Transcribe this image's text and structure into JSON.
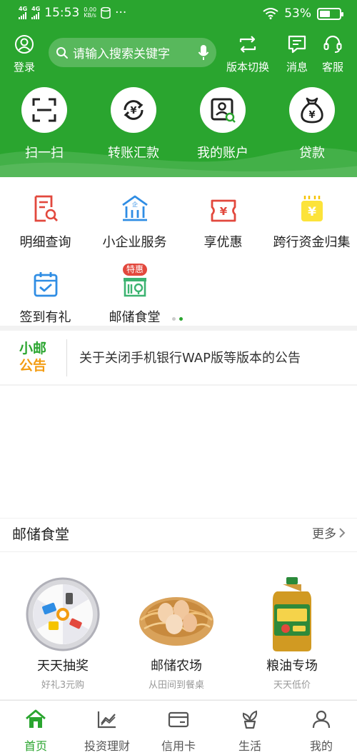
{
  "status_bar": {
    "net1": "4G",
    "net2": "4G",
    "time": "15:53",
    "speed_value": "0.00",
    "speed_unit": "KB/s",
    "more": "···",
    "battery": "53%"
  },
  "topbar": {
    "login": "登录",
    "search_placeholder": "请输入搜索关键字",
    "version_switch": "版本切换",
    "messages": "消息",
    "service": "客服"
  },
  "quick_actions": [
    {
      "label": "扫一扫",
      "icon": "scan-icon"
    },
    {
      "label": "转账汇款",
      "icon": "transfer-icon"
    },
    {
      "label": "我的账户",
      "icon": "account-icon"
    },
    {
      "label": "贷款",
      "icon": "loan-bag-icon"
    }
  ],
  "services": [
    {
      "label": "明细查询",
      "icon": "detail-query-icon"
    },
    {
      "label": "小企业服务",
      "icon": "enterprise-icon"
    },
    {
      "label": "享优惠",
      "icon": "coupon-icon"
    },
    {
      "label": "跨行资金归集",
      "icon": "fund-collection-icon"
    },
    {
      "label": "签到有礼",
      "icon": "checkin-icon"
    },
    {
      "label": "邮储食堂",
      "icon": "canteen-icon",
      "badge": "特惠"
    }
  ],
  "pager": {
    "count": 2,
    "active": 1
  },
  "notice": {
    "badge_line1": "小邮",
    "badge_line2": "公告",
    "text": "关于关闭手机银行WAP版等版本的公告"
  },
  "canteen": {
    "title": "邮储食堂",
    "more": "更多",
    "items": [
      {
        "name": "天天抽奖",
        "sub": "好礼3元购"
      },
      {
        "name": "邮储农场",
        "sub": "从田间到餐桌"
      },
      {
        "name": "粮油专场",
        "sub": "天天低价"
      }
    ]
  },
  "tabs": [
    {
      "label": "首页",
      "icon": "home-icon",
      "active": true
    },
    {
      "label": "投资理财",
      "icon": "invest-chart-icon",
      "active": false
    },
    {
      "label": "信用卡",
      "icon": "credit-card-icon",
      "active": false
    },
    {
      "label": "生活",
      "icon": "sprout-icon",
      "active": false
    },
    {
      "label": "我的",
      "icon": "user-icon",
      "active": false
    }
  ],
  "colors": {
    "brand_green": "#2aa52f",
    "accent_orange": "#f39c12",
    "icon_red": "#e2483d",
    "icon_blue": "#2f8de4"
  }
}
